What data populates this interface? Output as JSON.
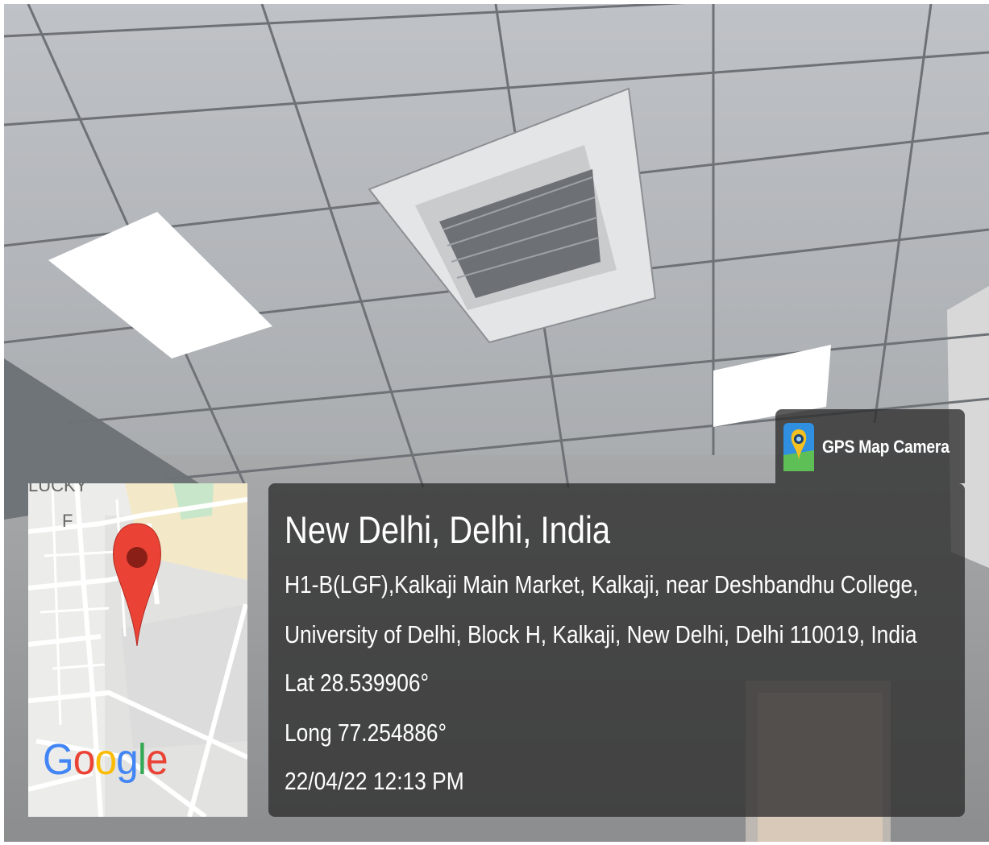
{
  "badge": {
    "label": "GPS Map Camera",
    "icon": "gps-map-camera-app-icon"
  },
  "location": {
    "title": "New Delhi, Delhi, India",
    "address_line1": "H1-B(LGF),Kalkaji Main Market, Kalkaji, near Deshbandhu College,",
    "address_line2": "University of Delhi, Block H, Kalkaji, New Delhi, Delhi 110019, India",
    "latitude": "Lat 28.539906°",
    "longitude": "Long 77.254886°",
    "datetime": "22/04/22 12:13 PM"
  },
  "map": {
    "logo_text": "Google",
    "logo_letters": [
      {
        "char": "G",
        "color": "#4285F4"
      },
      {
        "char": "o",
        "color": "#EA4335"
      },
      {
        "char": "o",
        "color": "#FBBC05"
      },
      {
        "char": "g",
        "color": "#4285F4"
      },
      {
        "char": "l",
        "color": "#34A853"
      },
      {
        "char": "e",
        "color": "#EA4335"
      }
    ],
    "pin_icon": "map-pin-icon",
    "pin_color": "#EA4335"
  }
}
